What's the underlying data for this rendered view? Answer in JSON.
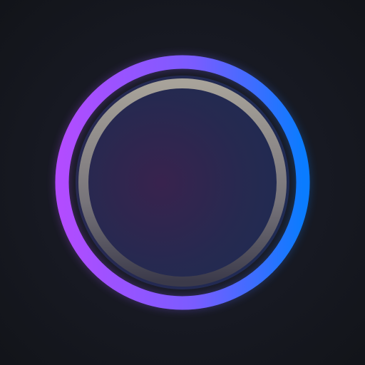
{
  "icon": {
    "name": "ring-logo-icon",
    "colors": {
      "background": "#16181f",
      "ring_gradient_start": "#b24cff",
      "ring_gradient_end": "#0a7cff",
      "inner_ring_top": "#a8a39a",
      "inner_ring_bottom": "#3b3a4a",
      "center_glow_left": "#3a2350",
      "center_glow_right": "#1f2c55"
    }
  }
}
